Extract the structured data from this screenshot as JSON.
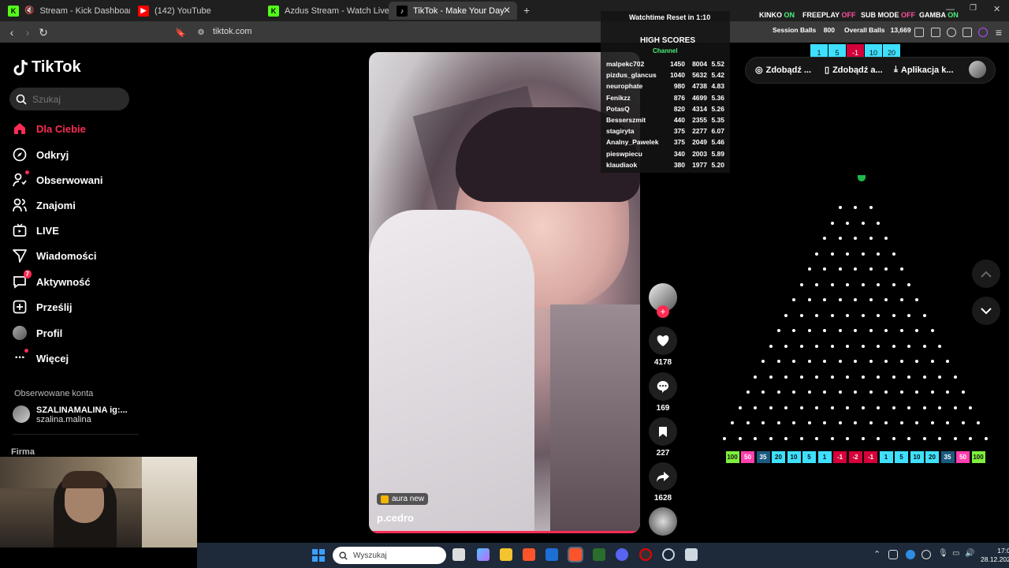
{
  "browser": {
    "tabs": [
      {
        "title": "Stream - Kick Dashboard",
        "favicon": "kick-icon",
        "active": false
      },
      {
        "title": "(142) YouTube",
        "favicon": "youtube-icon",
        "active": false
      },
      {
        "title": "Azdus Stream - Watch Live on Kick",
        "favicon": "kick-icon",
        "active": false
      },
      {
        "title": "TikTok - Make Your Day",
        "favicon": "tiktok-icon",
        "active": true
      }
    ],
    "url": "tiktok.com"
  },
  "sidebar": {
    "logo": "TikTok",
    "search_placeholder": "Szukaj",
    "items": [
      {
        "label": "Dla Ciebie",
        "icon": "home-icon",
        "active": true
      },
      {
        "label": "Odkryj",
        "icon": "compass-icon"
      },
      {
        "label": "Obserwowani",
        "icon": "following-icon",
        "dot": true
      },
      {
        "label": "Znajomi",
        "icon": "friends-icon"
      },
      {
        "label": "LIVE",
        "icon": "live-icon"
      },
      {
        "label": "Wiadomości",
        "icon": "messages-icon"
      },
      {
        "label": "Aktywność",
        "icon": "activity-icon",
        "badge": "7"
      },
      {
        "label": "Prześlij",
        "icon": "upload-icon"
      },
      {
        "label": "Profil",
        "icon": "avatar-icon"
      },
      {
        "label": "Więcej",
        "icon": "more-icon",
        "dot": true
      }
    ],
    "followed_title": "Obserwowane konta",
    "followed_accounts": [
      {
        "name": "SZALINAMALINA ig:...",
        "handle": "szalina.malina"
      }
    ],
    "firma": "Firma"
  },
  "video": {
    "badge": "aura new",
    "username": "p.cedro",
    "actions": {
      "likes": "4178",
      "comments": "169",
      "saves": "227",
      "shares": "1628"
    }
  },
  "overlay": {
    "watchtime": "Watchtime Reset in 1:10",
    "high_scores_title": "HIGH SCORES",
    "channel": "Channel",
    "scores": [
      {
        "name": "malpekc702",
        "a": "1450",
        "b": "8004",
        "c": "5.52"
      },
      {
        "name": "pizdus_glancus",
        "a": "1040",
        "b": "5632",
        "c": "5.42"
      },
      {
        "name": "neurophate",
        "a": "980",
        "b": "4738",
        "c": "4.83"
      },
      {
        "name": "Fenikzz",
        "a": "876",
        "b": "4699",
        "c": "5.36"
      },
      {
        "name": "PotasQ",
        "a": "820",
        "b": "4314",
        "c": "5.26"
      },
      {
        "name": "Besserszmit",
        "a": "440",
        "b": "2355",
        "c": "5.35"
      },
      {
        "name": "stagiryta",
        "a": "375",
        "b": "2277",
        "c": "6.07"
      },
      {
        "name": "Analny_Pawelek",
        "a": "375",
        "b": "2049",
        "c": "5.46"
      },
      {
        "name": "pieswpiecu",
        "a": "340",
        "b": "2003",
        "c": "5.89"
      },
      {
        "name": "klaudiaok",
        "a": "380",
        "b": "1977",
        "c": "5.20"
      }
    ],
    "status": {
      "kinko_label": "KINKO",
      "kinko_value": "ON",
      "freeplay_label": "FREEPLAY",
      "freeplay_value": "OFF",
      "submode_label": "SUB MODE",
      "submode_value": "OFF",
      "gamba_label": "GAMBA",
      "gamba_value": "ON"
    },
    "session_balls_label": "Session Balls",
    "session_balls_value": "800",
    "overall_balls_label": "Overall Balls",
    "overall_balls_value": "13,669",
    "bets": [
      "1",
      "5",
      "-1",
      "10",
      "20"
    ]
  },
  "right_panel": {
    "pill1": "Zdobądź ...",
    "pill2": "Zdobądź a...",
    "pill3": "Aplikacja k..."
  },
  "plinko": {
    "slots": [
      "100",
      "50",
      "35",
      "20",
      "10",
      "5",
      "1",
      "-1",
      "-2",
      "-1",
      "1",
      "5",
      "10",
      "20",
      "35",
      "50",
      "100"
    ],
    "slot_colors": [
      "#7ef03c",
      "#ff3fae",
      "#1b5a80",
      "#3ee0ff",
      "#3ee0ff",
      "#3ee0ff",
      "#3ee0ff",
      "#d4003a",
      "#d4003a",
      "#d4003a",
      "#3ee0ff",
      "#3ee0ff",
      "#3ee0ff",
      "#3ee0ff",
      "#1b5a80",
      "#ff3fae",
      "#7ef03c"
    ],
    "rows": 16
  },
  "taskbar": {
    "search_placeholder": "Wyszukaj",
    "time": "17:05",
    "date": "28.12.2025"
  },
  "colors": {
    "accent": "#fe2c55"
  }
}
